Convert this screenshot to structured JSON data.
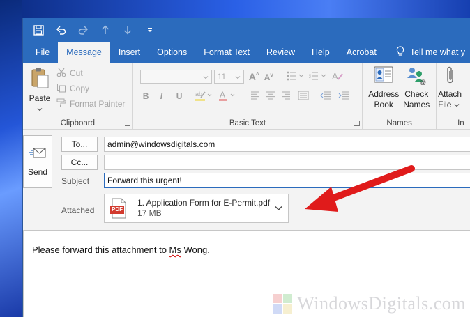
{
  "titlebar": {
    "icons": [
      "save-icon",
      "undo-icon",
      "redo-icon",
      "arrow-up-icon",
      "arrow-down-icon",
      "customize-qat-icon"
    ]
  },
  "tabs": [
    {
      "label": "File",
      "active": false
    },
    {
      "label": "Message",
      "active": true
    },
    {
      "label": "Insert",
      "active": false
    },
    {
      "label": "Options",
      "active": false
    },
    {
      "label": "Format Text",
      "active": false
    },
    {
      "label": "Review",
      "active": false
    },
    {
      "label": "Help",
      "active": false
    },
    {
      "label": "Acrobat",
      "active": false
    }
  ],
  "tell_me": "Tell me what y",
  "ribbon": {
    "clipboard": {
      "paste": "Paste",
      "cut": "Cut",
      "copy": "Copy",
      "format_painter": "Format Painter",
      "label": "Clipboard"
    },
    "basic_text": {
      "font_size": "11",
      "bold": "B",
      "italic": "I",
      "underline": "U",
      "label": "Basic Text"
    },
    "names": {
      "address_book_1": "Address",
      "address_book_2": "Book",
      "check_names_1": "Check",
      "check_names_2": "Names",
      "label": "Names"
    },
    "include": {
      "attach_file_1": "Attach",
      "attach_file_2": "File",
      "label": "In"
    }
  },
  "compose": {
    "send": "Send",
    "to_button": "To...",
    "cc_button": "Cc...",
    "to_value": "admin@windowsdigitals.com",
    "cc_value": "",
    "subject_label": "Subject",
    "subject_value": "Forward this urgent!",
    "attached_label": "Attached",
    "attachment": {
      "name": "1. Application Form for E-Permit.pdf",
      "size": "17 MB",
      "badge": "PDF"
    },
    "body_before": "Please forward this attachment to ",
    "body_misspelled": "Ms",
    "body_after": " Wong."
  },
  "watermark": "WindowsDigitals.com",
  "colors": {
    "accent": "#2b6bbd",
    "pdf_red": "#d23a2e",
    "arrow_red": "#e01b1b"
  }
}
